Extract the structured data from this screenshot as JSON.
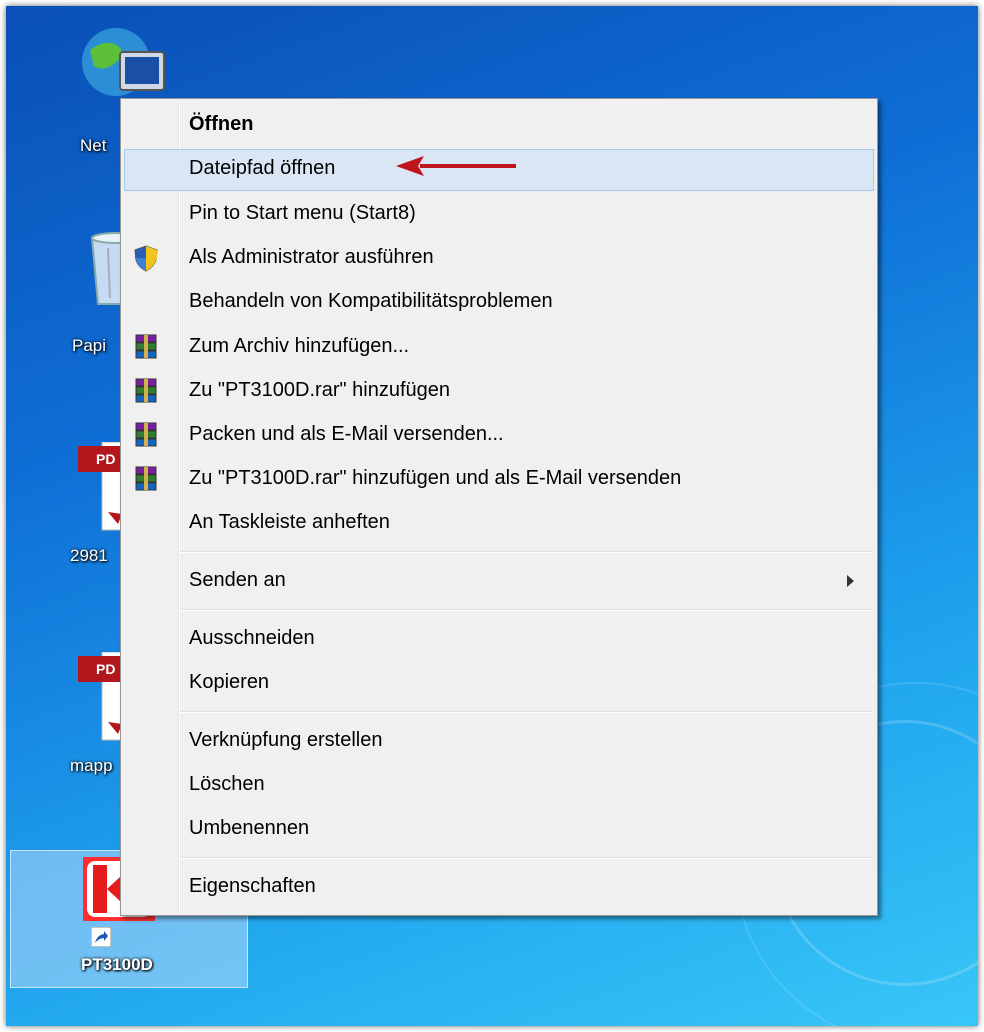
{
  "desktop": {
    "icons": [
      {
        "name": "network",
        "label": "Net"
      },
      {
        "name": "recycle-bin",
        "label": "Papi"
      },
      {
        "name": "pdf-file-1",
        "label": "2981"
      },
      {
        "name": "pdf-file-2",
        "label": "mapp"
      },
      {
        "name": "pt3100d-shortcut",
        "label": "PT3100D"
      }
    ],
    "pdf_badge": "PD"
  },
  "context_menu": {
    "items": [
      {
        "label": "Öffnen",
        "bold": true,
        "icon": null
      },
      {
        "label": "Dateipfad öffnen",
        "hover": true,
        "icon": null
      },
      {
        "label": "Pin to Start menu (Start8)",
        "icon": null
      },
      {
        "label": "Als Administrator ausführen",
        "icon": "uac-shield-icon"
      },
      {
        "label": "Behandeln von Kompatibilitätsproblemen",
        "icon": null
      },
      {
        "label": "Zum Archiv hinzufügen...",
        "icon": "winrar-icon"
      },
      {
        "label": "Zu \"PT3100D.rar\" hinzufügen",
        "icon": "winrar-icon"
      },
      {
        "label": "Packen und als E-Mail versenden...",
        "icon": "winrar-icon"
      },
      {
        "label": "Zu \"PT3100D.rar\" hinzufügen und als E-Mail versenden",
        "icon": "winrar-icon"
      },
      {
        "label": "An Taskleiste anheften",
        "icon": null
      },
      {
        "label": "Senden an",
        "submenu": true,
        "icon": null
      },
      {
        "label": "Ausschneiden",
        "icon": null
      },
      {
        "label": "Kopieren",
        "icon": null
      },
      {
        "label": "Verknüpfung erstellen",
        "icon": null
      },
      {
        "label": "Löschen",
        "icon": null
      },
      {
        "label": "Umbenennen",
        "icon": null
      },
      {
        "label": "Eigenschaften",
        "icon": null
      }
    ]
  },
  "annotation": {
    "arrow_color": "#c0141c"
  }
}
